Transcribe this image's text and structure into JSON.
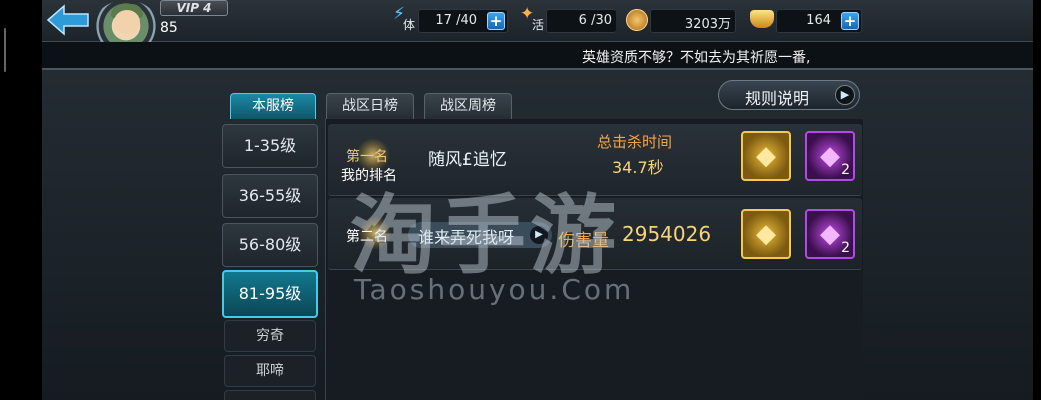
{
  "header": {
    "vip_label": "VIP 4",
    "player_level": "85",
    "resources": {
      "stamina": {
        "label": "体",
        "value": "17 /40"
      },
      "activity": {
        "label": "活",
        "value": "6 /30"
      },
      "coins": {
        "value": "3203万"
      },
      "ingots": {
        "value": "164"
      }
    }
  },
  "announcement": "英雄资质不够？不如去为其祈愿一番,",
  "tabs": [
    {
      "label": "本服榜",
      "active": true
    },
    {
      "label": "战区日榜",
      "active": false
    },
    {
      "label": "战区周榜",
      "active": false
    }
  ],
  "rules_button": {
    "label": "规则说明"
  },
  "level_brackets": [
    {
      "label": "1-35级"
    },
    {
      "label": "36-55级"
    },
    {
      "label": "56-80级"
    },
    {
      "label": "81-95级",
      "active": true
    }
  ],
  "sub_items": [
    {
      "label": "穷奇"
    },
    {
      "label": "耶啼"
    }
  ],
  "rankings": [
    {
      "rank_label": "第一名",
      "sub_label": "我的排名",
      "player_name": "随风£追忆",
      "stat_label": "总击杀时间",
      "stat_value": "34.7秒",
      "rewards": [
        {
          "type": "gold-chest",
          "count": ""
        },
        {
          "type": "purple-gem",
          "count": "2"
        }
      ]
    },
    {
      "rank_label": "第二名",
      "player_name": "谁来弄死我呀",
      "stat_label": "伤害量",
      "stat_value": "2954026",
      "rewards": [
        {
          "type": "gold-chest",
          "count": ""
        },
        {
          "type": "purple-gem",
          "count": "2"
        }
      ]
    }
  ],
  "watermark": {
    "main": "淘手游",
    "sub": "Taoshouyou.Com"
  },
  "icons": {
    "back": "back-arrow-icon",
    "stamina": "lightning-icon",
    "activity": "flame-icon",
    "coin": "coin-icon",
    "ingot": "gold-ingot-icon",
    "plus": "plus-icon"
  },
  "colors": {
    "accent": "#1b8aa6",
    "gold_text": "#f6d47a",
    "orange_text": "#f2a44a"
  }
}
